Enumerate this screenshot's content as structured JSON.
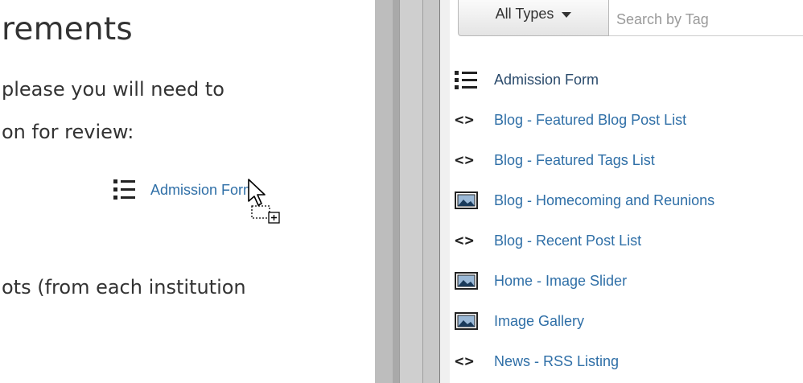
{
  "editor": {
    "heading": "rements",
    "paragraph_line1": "please you will need to",
    "paragraph_line2": "on for review:",
    "dropped_item": {
      "label": "Admission Form",
      "icon": "list-icon"
    },
    "paragraph_line3": "ots (from each institution"
  },
  "panel": {
    "type_filter": {
      "label": "All Types",
      "icon": "caret-down-icon"
    },
    "search": {
      "placeholder": "Search by Tag",
      "value": ""
    },
    "items": [
      {
        "label": "Admission Form",
        "icon": "list-icon"
      },
      {
        "label": "Blog - Featured Blog Post List",
        "icon": "code-icon"
      },
      {
        "label": "Blog - Featured Tags List",
        "icon": "code-icon"
      },
      {
        "label": "Blog - Homecoming and Reunions",
        "icon": "image-icon"
      },
      {
        "label": "Blog - Recent Post List",
        "icon": "code-icon"
      },
      {
        "label": "Home - Image Slider",
        "icon": "image-icon"
      },
      {
        "label": "Image Gallery",
        "icon": "image-icon"
      },
      {
        "label": "News - RSS Listing",
        "icon": "code-icon"
      }
    ]
  },
  "colors": {
    "link": "#2f6fa7",
    "text": "#333333",
    "divider": "#bdbdbd"
  }
}
